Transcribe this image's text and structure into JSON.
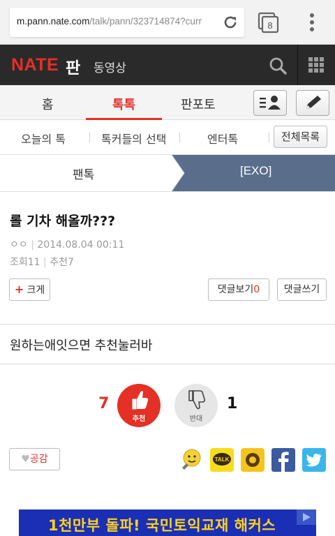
{
  "browser": {
    "url_host": "m.pann.nate.com",
    "url_path": "/talk/pann/323714874?curr",
    "tab_count": "8"
  },
  "header": {
    "logo": "NATE",
    "logo_sub": "판",
    "video_label": "동영상"
  },
  "main_tabs": [
    {
      "label": "홈"
    },
    {
      "label": "톡톡"
    },
    {
      "label": "판포토"
    }
  ],
  "sub_tabs": [
    {
      "label": "오늘의 톡"
    },
    {
      "label": "톡커들의 선택"
    },
    {
      "label": "엔터톡"
    }
  ],
  "all_list_button": "전체목록",
  "breadcrumb": {
    "first": "팬톡",
    "second": "[EXO]"
  },
  "post": {
    "title": "롤 기차 해올까???",
    "author": "ㅇㅇ",
    "date": "2014.08.04 00:11",
    "views_label": "조회11",
    "recommend_label": "추천7",
    "bigger_label": "크게",
    "view_comments_label": "댓글보기",
    "comment_count": "0",
    "write_comment_label": "댓글쓰기",
    "body": "원하는애잇으면 추천눌러바"
  },
  "vote": {
    "up_count": "7",
    "up_label": "추천",
    "down_label": "반대",
    "down_count": "1"
  },
  "share": {
    "empathy_label": "공감",
    "icons": [
      "emoticon-icon",
      "kakaotalk-icon",
      "kakaostory-icon",
      "facebook-icon",
      "twitter-icon"
    ]
  },
  "ad": {
    "text": "1천만부 돌파! 국민토익교재 해커스"
  },
  "colors": {
    "accent": "#e53025",
    "header_bg": "#2a2a2a",
    "crumb_active": "#5a6e8c"
  }
}
